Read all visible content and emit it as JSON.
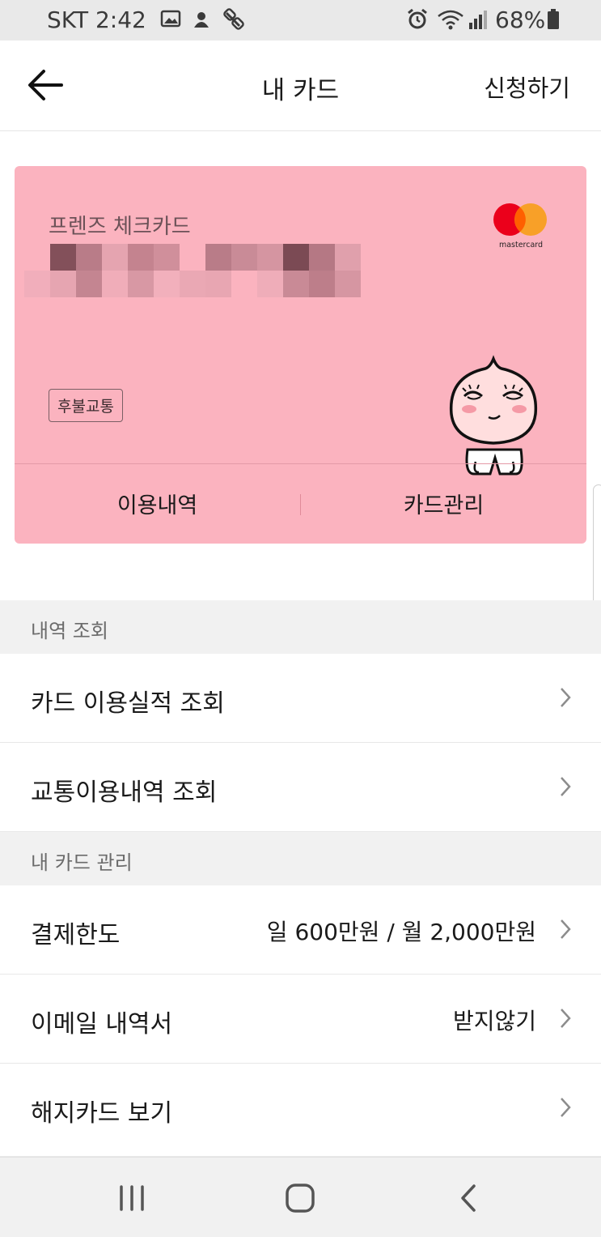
{
  "status_bar": {
    "carrier_time": "SKT 2:42",
    "battery": "68%",
    "icons": [
      "image-icon",
      "app-icon",
      "app-icon-2",
      "alarm-icon",
      "wifi-icon",
      "signal-icon",
      "battery-icon"
    ]
  },
  "header": {
    "title": "내 카드",
    "action": "신청하기",
    "back_icon": "arrow-left-icon"
  },
  "card": {
    "name": "프렌즈 체크카드",
    "network": "mastercard",
    "badge": "후불교통",
    "tabs": [
      "이용내역",
      "카드관리"
    ],
    "colors": {
      "background": "#fbb3bf",
      "mc_red": "#eb001b",
      "mc_orange": "#f79e1b"
    }
  },
  "sections": [
    {
      "title": "내역 조회",
      "items": [
        {
          "label": "카드 이용실적 조회",
          "value": ""
        },
        {
          "label": "교통이용내역 조회",
          "value": ""
        }
      ]
    },
    {
      "title": "내 카드 관리",
      "items": [
        {
          "label": "결제한도",
          "value": "일 600만원 / 월 2,000만원"
        },
        {
          "label": "이메일 내역서",
          "value": "받지않기"
        },
        {
          "label": "해지카드 보기",
          "value": ""
        }
      ]
    }
  ],
  "nav": {
    "icons": [
      "recent-apps-icon",
      "home-icon",
      "back-icon"
    ]
  }
}
